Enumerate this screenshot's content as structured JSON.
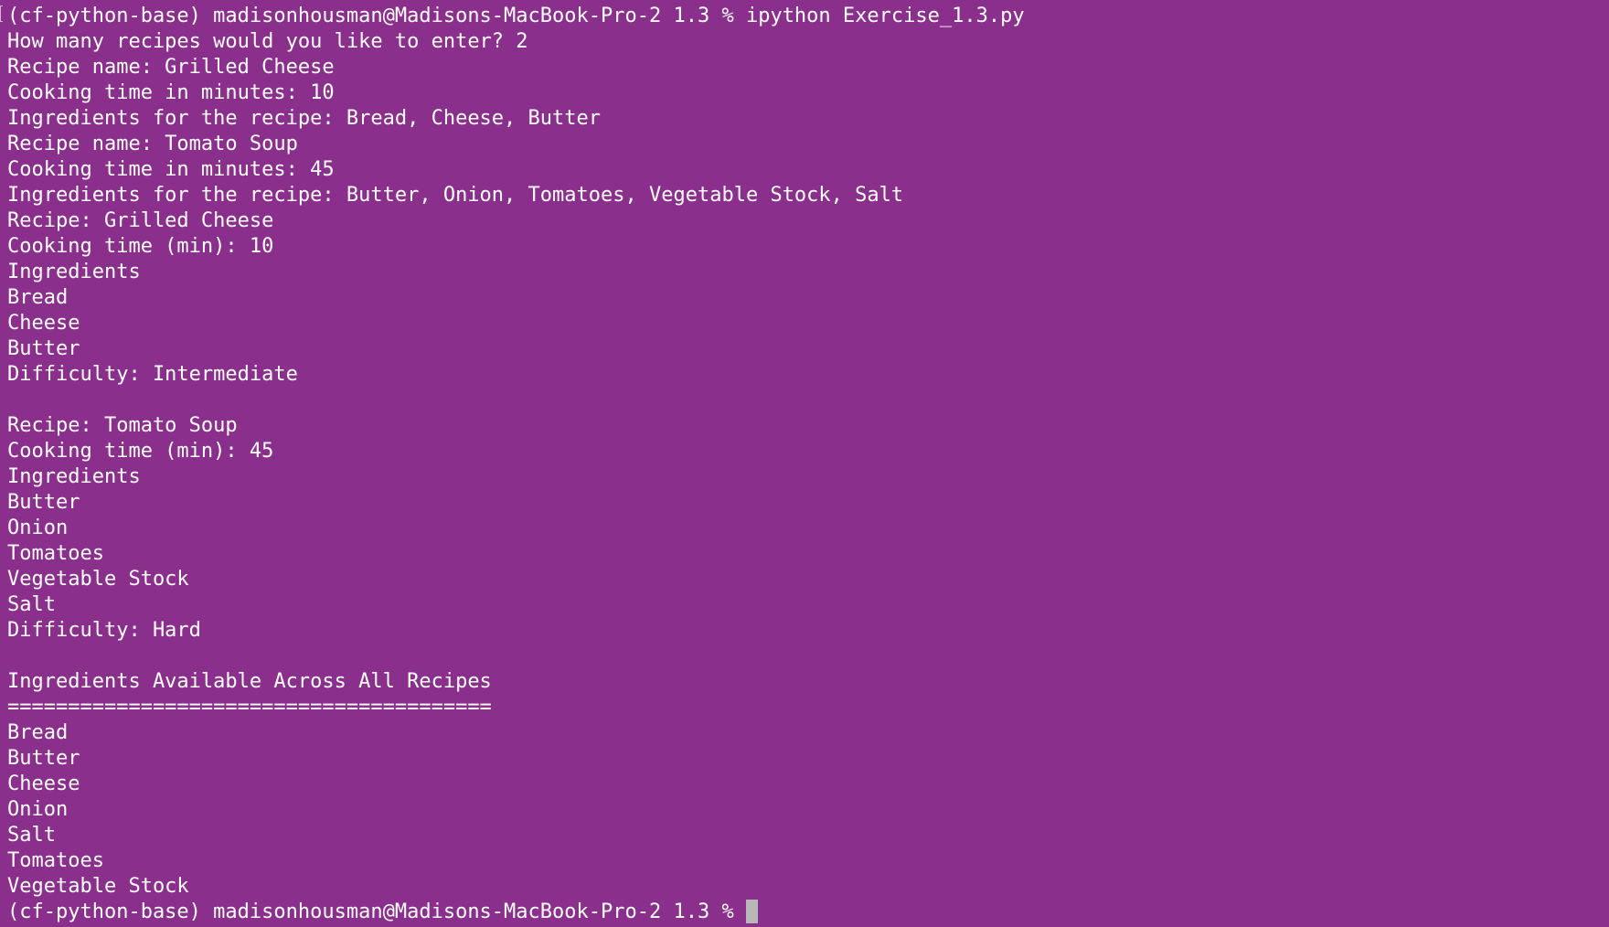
{
  "terminal": {
    "prompt_prefix": "(cf-python-base) madisonhousman@Madisons-MacBook-Pro-2 1.3 % ",
    "lines": [
      "(cf-python-base) madisonhousman@Madisons-MacBook-Pro-2 1.3 % ipython Exercise_1.3.py",
      "How many recipes would you like to enter? 2",
      "Recipe name: Grilled Cheese",
      "Cooking time in minutes: 10",
      "Ingredients for the recipe: Bread, Cheese, Butter",
      "Recipe name: Tomato Soup",
      "Cooking time in minutes: 45",
      "Ingredients for the recipe: Butter, Onion, Tomatoes, Vegetable Stock, Salt",
      "Recipe: Grilled Cheese",
      "Cooking time (min): 10",
      "Ingredients",
      "Bread",
      "Cheese",
      "Butter",
      "Difficulty: Intermediate",
      "",
      "Recipe: Tomato Soup",
      "Cooking time (min): 45",
      "Ingredients",
      "Butter",
      "Onion",
      "Tomatoes",
      "Vegetable Stock",
      "Salt",
      "Difficulty: Hard",
      "",
      "Ingredients Available Across All Recipes",
      "========================================",
      "Bread",
      "Butter",
      "Cheese",
      "Onion",
      "Salt",
      "Tomatoes",
      "Vegetable Stock"
    ],
    "colors": {
      "background": "#8a2f8b",
      "text": "#ffffff",
      "cursor": "#b8b8b8"
    }
  }
}
